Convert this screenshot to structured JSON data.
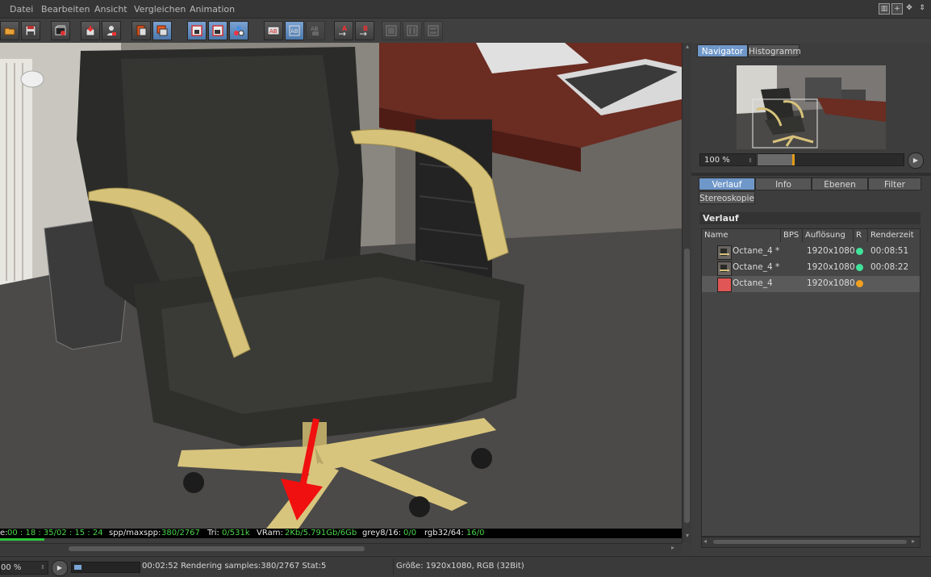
{
  "menu": {
    "items": [
      "Datei",
      "Bearbeiten",
      "Ansicht",
      "Vergleichen",
      "Animation"
    ]
  },
  "toolbar": {
    "buttons": [
      {
        "icon": "open-folder-icon"
      },
      {
        "icon": "save-icon"
      },
      {
        "icon": "render-settings-icon"
      },
      {
        "icon": "copy-to-render-icon"
      },
      {
        "icon": "user-icon"
      },
      {
        "icon": "stack-icon"
      },
      {
        "icon": "layers-icon"
      },
      {
        "icon": "region-render-icon"
      },
      {
        "icon": "camera-region-icon"
      },
      {
        "icon": "compare-icon"
      },
      {
        "icon": "ab-compare-icon"
      },
      {
        "icon": "ab-overlay-icon"
      },
      {
        "icon": "ab-split-icon"
      },
      {
        "icon": "set-a-icon",
        "label": "A"
      },
      {
        "icon": "set-b-icon",
        "label": "B"
      },
      {
        "icon": "layout-1-icon"
      },
      {
        "icon": "layout-2-icon"
      },
      {
        "icon": "layout-3-icon"
      }
    ]
  },
  "render_stats": {
    "time_label": "e:",
    "time_value": "00 : 18 : 35/02 : 15 : 24",
    "spp_label": "spp/maxspp:",
    "spp_value": "380/2767",
    "tri_label": "Tri:",
    "tri_value": "0/531k",
    "vram_label": "VRam:",
    "vram_value": "2Kb/5.791Gb/6Gb",
    "grey_label": "grey8/16:",
    "grey_value": "0/0",
    "rgb_label": "rgb32/64:",
    "rgb_value": "16/0",
    "progress": 0.065
  },
  "statusbar": {
    "zoom": "00 %",
    "status": "00:02:52 Rendering samples:380/2767 Stat:5",
    "info": "Größe: 1920x1080, RGB (32Bit)",
    "progress": 0.12
  },
  "navigator": {
    "tabs": [
      "Navigator",
      "Histogramm"
    ],
    "active_tab": "Navigator",
    "zoom": "100 %",
    "slider_value": 0.24
  },
  "history": {
    "tabs": [
      "Verlauf",
      "Info",
      "Ebenen",
      "Filter",
      "Stereoskopie"
    ],
    "active_tab": "Verlauf",
    "header": "Verlauf",
    "columns": [
      "Name",
      "BPS",
      "Auflösung",
      "R",
      "Renderzeit"
    ],
    "rows": [
      {
        "name": "Octane_4 *",
        "bps": "",
        "resolution": "1920x1080",
        "status_color": "#3fe39a",
        "time": "00:08:51",
        "selected": false
      },
      {
        "name": "Octane_4 *",
        "bps": "",
        "resolution": "1920x1080",
        "status_color": "#3fe39a",
        "time": "00:08:22",
        "selected": false
      },
      {
        "name": "Octane_4",
        "bps": "",
        "resolution": "1920x1080",
        "status_color": "#f0a020",
        "time": "",
        "selected": true
      }
    ]
  },
  "colors": {
    "accent": "#6f97c9",
    "ok": "#3fe39a",
    "rendering": "#f0a020",
    "stats_green": "#4cd64c"
  }
}
